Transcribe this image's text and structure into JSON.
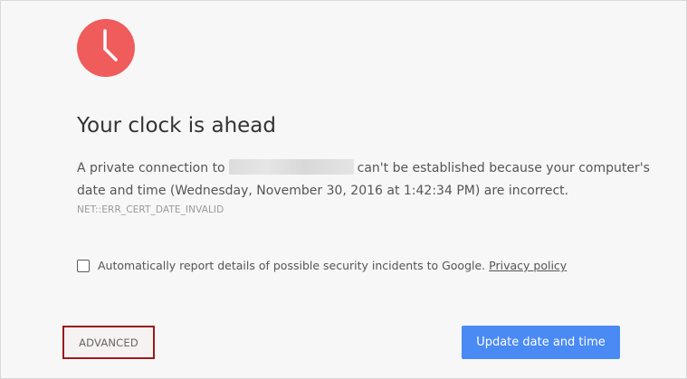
{
  "colors": {
    "background": "#f7f7f7",
    "icon_red": "#f05b5b",
    "primary_button": "#4a8af4",
    "highlight_border": "#9b1b1b"
  },
  "icon": "clock-icon",
  "title": "Your clock is ahead",
  "message": {
    "prefix": "A private connection to",
    "suffix": "can't be established because your computer's",
    "line2": "date and time (Wednesday, November 30, 2016 at 1:42:34 PM) are incorrect."
  },
  "error_code": "NET::ERR_CERT_DATE_INVALID",
  "report": {
    "checked": false,
    "label": "Automatically report details of possible security incidents to Google.",
    "link": "Privacy policy"
  },
  "buttons": {
    "advanced": "ADVANCED",
    "update": "Update date and time"
  }
}
